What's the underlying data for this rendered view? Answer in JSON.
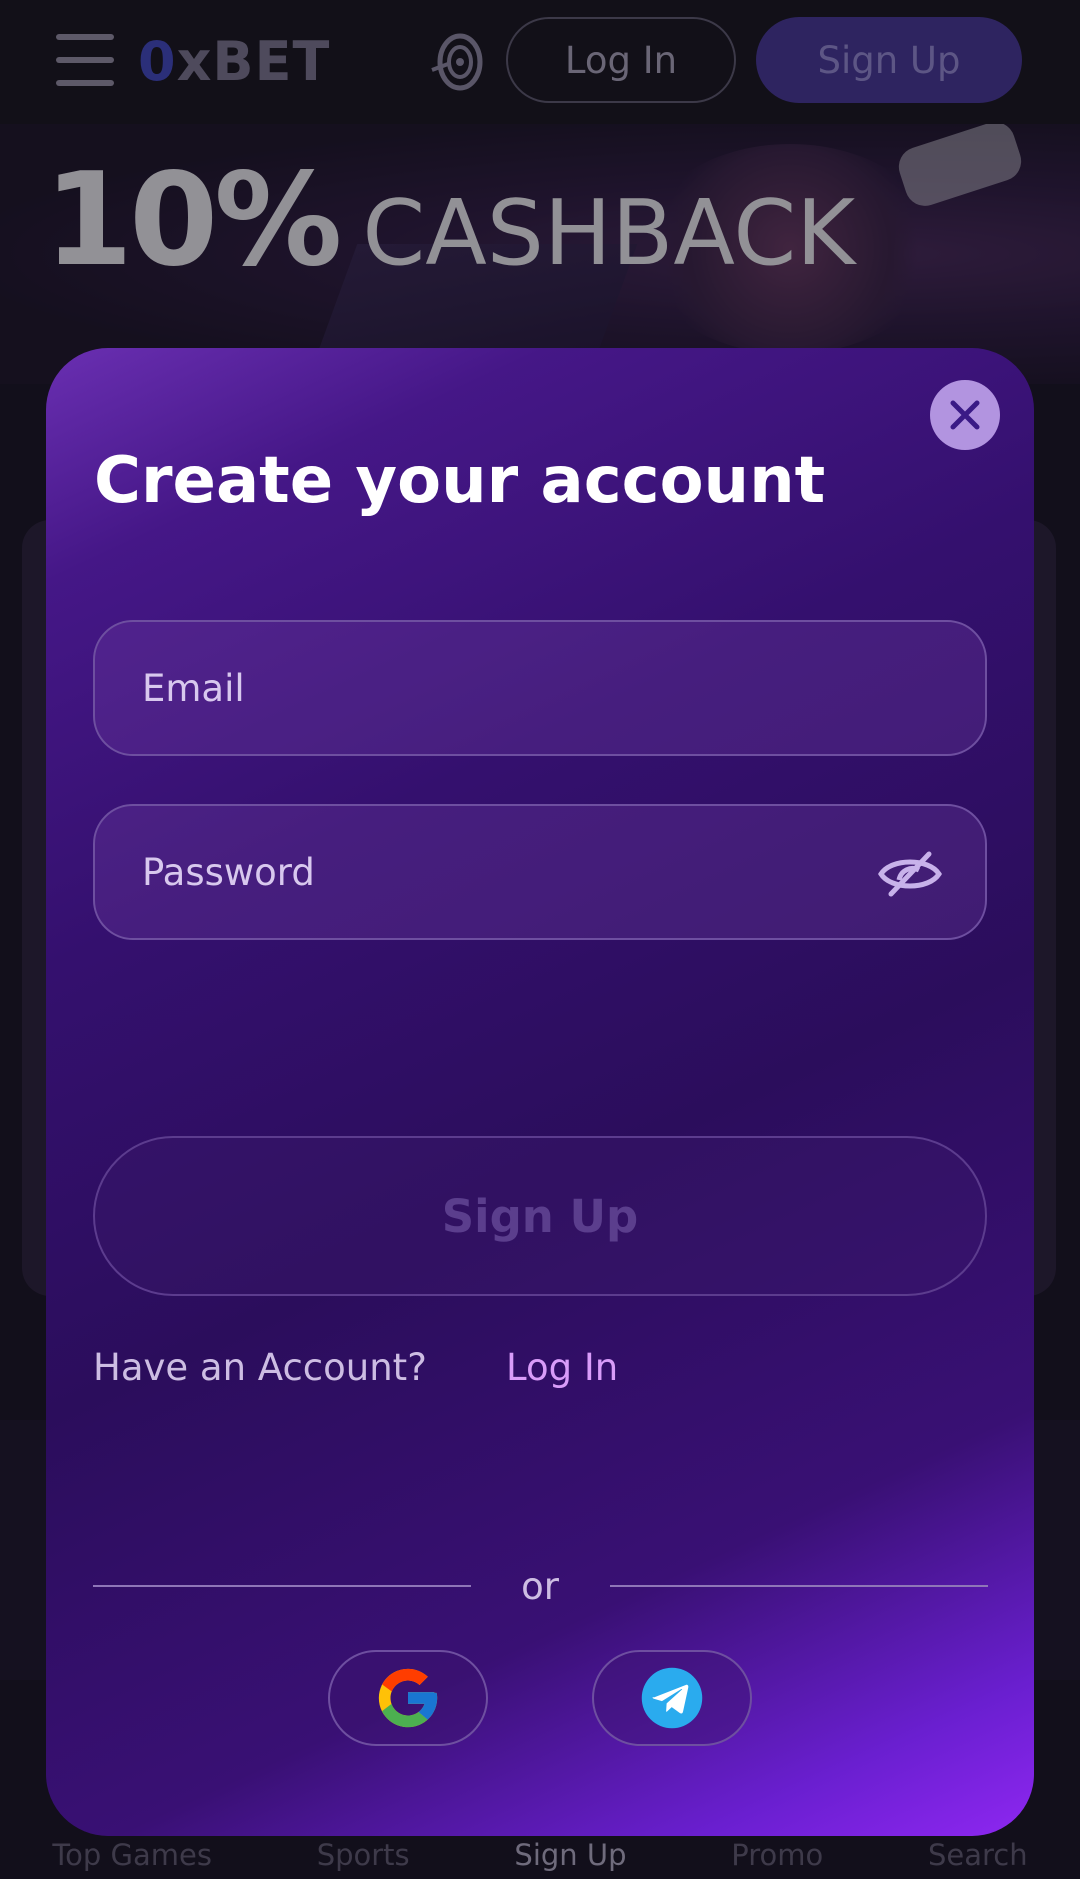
{
  "header": {
    "logo_zero": "0",
    "logo_text": "xBET",
    "login_label": "Log In",
    "signup_label": "Sign Up"
  },
  "hero": {
    "percent": "10%",
    "word": "CASHBACK"
  },
  "modal": {
    "title": "Create your account",
    "email_placeholder": "Email",
    "password_placeholder": "Password",
    "signup_label": "Sign Up",
    "have_account_text": "Have an Account?",
    "login_link_label": "Log In",
    "or_text": "or"
  },
  "bottom_nav": {
    "items": [
      "Top Games",
      "Sports",
      "Sign Up",
      "Promo",
      "Search"
    ]
  },
  "colors": {
    "modal_gradient_start": "#451787",
    "modal_gradient_end": "#8e27f1",
    "link": "#d99cf9",
    "close_button": "#b294e0"
  }
}
